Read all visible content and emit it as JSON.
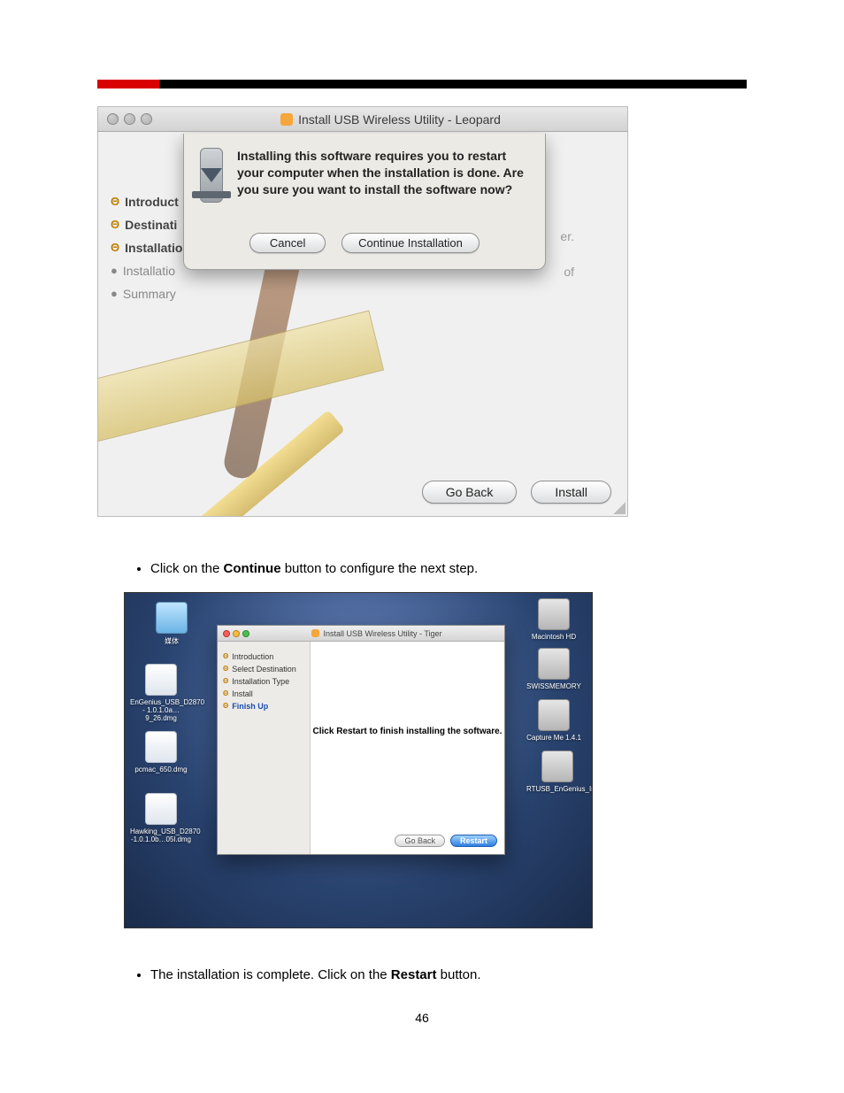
{
  "shot1": {
    "title": "Install USB Wireless Utility - Leopard",
    "steps": [
      "Introduct",
      "Destinati",
      "Installatio",
      "Installatio",
      "Summary"
    ],
    "sheet_msg": "Installing this software requires you to restart your computer when the installation is done. Are you sure you want to install the software now?",
    "btn_cancel": "Cancel",
    "btn_continue": "Continue Installation",
    "bg_trail1": "er.",
    "bg_trail2": "of",
    "btn_back": "Go Back",
    "btn_install": "Install"
  },
  "instr1_pre": "Click on the ",
  "instr1_bold": "Continue",
  "instr1_post": " button to configure the next step.",
  "shot2": {
    "title": "Install USB Wireless Utility - Tiger",
    "steps": [
      "Introduction",
      "Select Destination",
      "Installation Type",
      "Install",
      "Finish Up"
    ],
    "msg": "Click Restart to finish installing the software.",
    "btn_back": "Go Back",
    "btn_restart": "Restart",
    "left_icons": [
      {
        "label": "媒体"
      },
      {
        "label": "EnGenius_USB_D2870 - 1.0.1.0a…9_26.dmg"
      },
      {
        "label": "pcmac_650.dmg"
      },
      {
        "label": "Hawking_USB_D2870 -1.0.1.0b…05l.dmg"
      }
    ],
    "right_icons": [
      {
        "label": "Macintosh HD"
      },
      {
        "label": "SWISSMEMORY"
      },
      {
        "label": "Capture Me 1.4.1"
      },
      {
        "label": "RTUSB_EnGenius_Installer"
      }
    ]
  },
  "instr2_pre": "The installation is complete. Click on the ",
  "instr2_bold": "Restart",
  "instr2_post": " button.",
  "page_number": "46"
}
